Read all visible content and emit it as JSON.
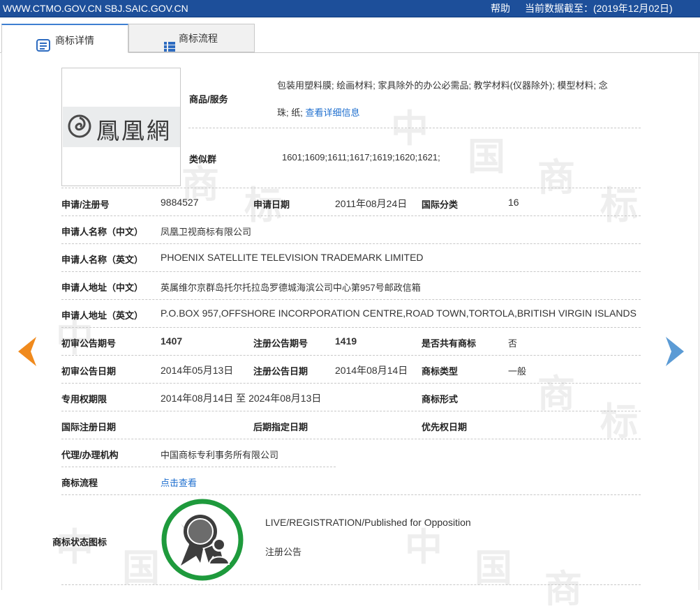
{
  "header": {
    "site": "WWW.CTMO.GOV.CN SBJ.SAIC.GOV.CN",
    "help": "帮助",
    "date_label": "当前数据截至：",
    "date_value": "(2019年12月02日)"
  },
  "tabs": [
    {
      "label": "商标详情",
      "icon": "document-list-icon"
    },
    {
      "label": "商标流程",
      "icon": "list-icon"
    }
  ],
  "trademark_image": {
    "text": "鳳凰網",
    "icon": "phoenix-swirl-logo"
  },
  "goods": {
    "label": "商品/服务",
    "line1": "包装用塑料膜; 绘画材料; 家具除外的办公必需品; 教学材料(仪器除外); 模型材料; 念",
    "line2": "珠; 纸;",
    "link": "查看详细信息"
  },
  "similar_group": {
    "label": "类似群",
    "value": "1601;1609;1611;1617;1619;1620;1621;"
  },
  "fields": {
    "reg_no_label": "申请/注册号",
    "reg_no": "9884527",
    "app_date_label": "申请日期",
    "app_date": "2011年08月24日",
    "intl_class_label": "国际分类",
    "intl_class": "16",
    "applicant_cn_label": "申请人名称（中文）",
    "applicant_cn": "凤凰卫视商标有限公司",
    "applicant_en_label": "申请人名称（英文）",
    "applicant_en": "PHOENIX SATELLITE TELEVISION TRADEMARK LIMITED",
    "address_cn_label": "申请人地址（中文）",
    "address_cn": "英属维尔京群岛托尔托拉岛罗德城海滨公司中心第957号邮政信箱",
    "address_en_label": "申请人地址（英文）",
    "address_en": "P.O.BOX 957,OFFSHORE INCORPORATION CENTRE,ROAD TOWN,TORTOLA,BRITISH VIRGIN ISLANDS",
    "prelim_no_label": "初审公告期号",
    "prelim_no": "1407",
    "reg_pub_no_label": "注册公告期号",
    "reg_pub_no": "1419",
    "shared_label": "是否共有商标",
    "shared": "否",
    "prelim_date_label": "初审公告日期",
    "prelim_date": "2014年05月13日",
    "reg_pub_date_label": "注册公告日期",
    "reg_pub_date": "2014年08月14日",
    "tm_type_label": "商标类型",
    "tm_type": "一般",
    "exclusive_label": "专用权期限",
    "exclusive": "2014年08月14日 至 2024年08月13日",
    "tm_form_label": "商标形式",
    "intl_reg_label": "国际注册日期",
    "later_label": "后期指定日期",
    "priority_label": "优先权日期",
    "agent_label": "代理/办理机构",
    "agent": "中国商标专利事务所有限公司",
    "flow_label": "商标流程",
    "flow_link": "点击查看",
    "status_label": "商标状态图标",
    "status_en": "LIVE/REGISTRATION/Published for Opposition",
    "status_cn": "注册公告"
  },
  "watermark": [
    "中",
    "国",
    "商",
    "标"
  ],
  "colors": {
    "topbar": "#1d4f9a",
    "prev_arrow": "#f08a1d",
    "next_arrow": "#5b9bd5",
    "status_ring": "#1e9a3c",
    "link": "#1f6fcf"
  }
}
